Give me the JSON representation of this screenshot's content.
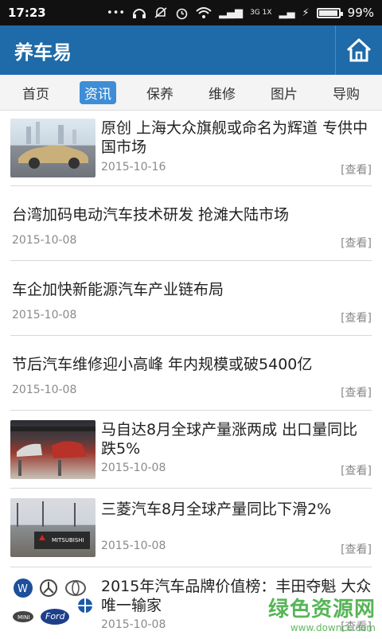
{
  "status_bar": {
    "time": "17:23",
    "network": "3G 1X",
    "battery": "99%",
    "battery_level": 0.99
  },
  "app": {
    "title": "养车易"
  },
  "tabs": [
    {
      "label": "首页",
      "active": false
    },
    {
      "label": "资讯",
      "active": true
    },
    {
      "label": "保养",
      "active": false
    },
    {
      "label": "维修",
      "active": false
    },
    {
      "label": "图片",
      "active": false
    },
    {
      "label": "导购",
      "active": false
    }
  ],
  "news": [
    {
      "title": "原创 上海大众旗舰或命名为辉道 专供中国市场",
      "date": "2015-10-16",
      "view": "[查看]",
      "thumb": "car-image"
    },
    {
      "title": "台湾加码电动汽车技术研发 抢滩大陆市场",
      "date": "2015-10-08",
      "view": "[查看]"
    },
    {
      "title": "车企加快新能源汽车产业链布局",
      "date": "2015-10-08",
      "view": "[查看]"
    },
    {
      "title": "节后汽车维修迎小高峰 年内规模或破5400亿",
      "date": "2015-10-08",
      "view": "[查看]"
    },
    {
      "title": "马自达8月全球产量涨两成 出口量同比跌5%",
      "date": "2015-10-08",
      "view": "[查看]",
      "thumb": "factory-image"
    },
    {
      "title": "三菱汽车8月全球产量同比下滑2%",
      "date": "2015-10-08",
      "view": "[查看]",
      "thumb": "mitsubishi-image",
      "thumb_text": "MITSUBISHI"
    },
    {
      "title": "2015年汽车品牌价值榜：丰田夺魁 大众唯一输家",
      "date": "2015-10-08",
      "view": "[查看]",
      "thumb": "brand-logos-image",
      "thumb_text": "Ford"
    }
  ],
  "watermark": {
    "line1": "绿色资源网",
    "line2": "www.downcc.com"
  }
}
